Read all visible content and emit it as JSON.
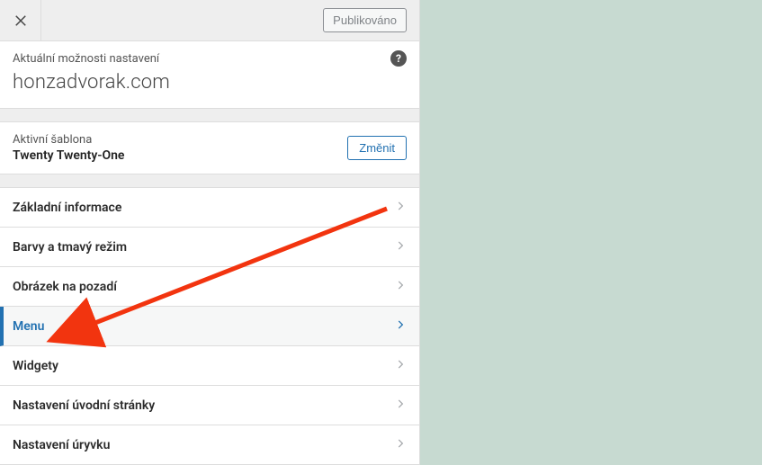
{
  "topbar": {
    "publish_label": "Publikováno"
  },
  "header": {
    "caption": "Aktuální možnosti nastavení",
    "site_title": "honzadvorak.com",
    "help_glyph": "?"
  },
  "theme": {
    "caption": "Aktivní šablona",
    "name": "Twenty Twenty-One",
    "change_label": "Změnit"
  },
  "sections": [
    {
      "label": "Základní informace",
      "active": false
    },
    {
      "label": "Barvy a tmavý režim",
      "active": false
    },
    {
      "label": "Obrázek na pozadí",
      "active": false
    },
    {
      "label": "Menu",
      "active": true
    },
    {
      "label": "Widgety",
      "active": false
    },
    {
      "label": "Nastavení úvodní stránky",
      "active": false
    },
    {
      "label": "Nastavení úryvku",
      "active": false
    }
  ],
  "colors": {
    "accent": "#2271b1",
    "preview_bg": "#c7dad1"
  }
}
